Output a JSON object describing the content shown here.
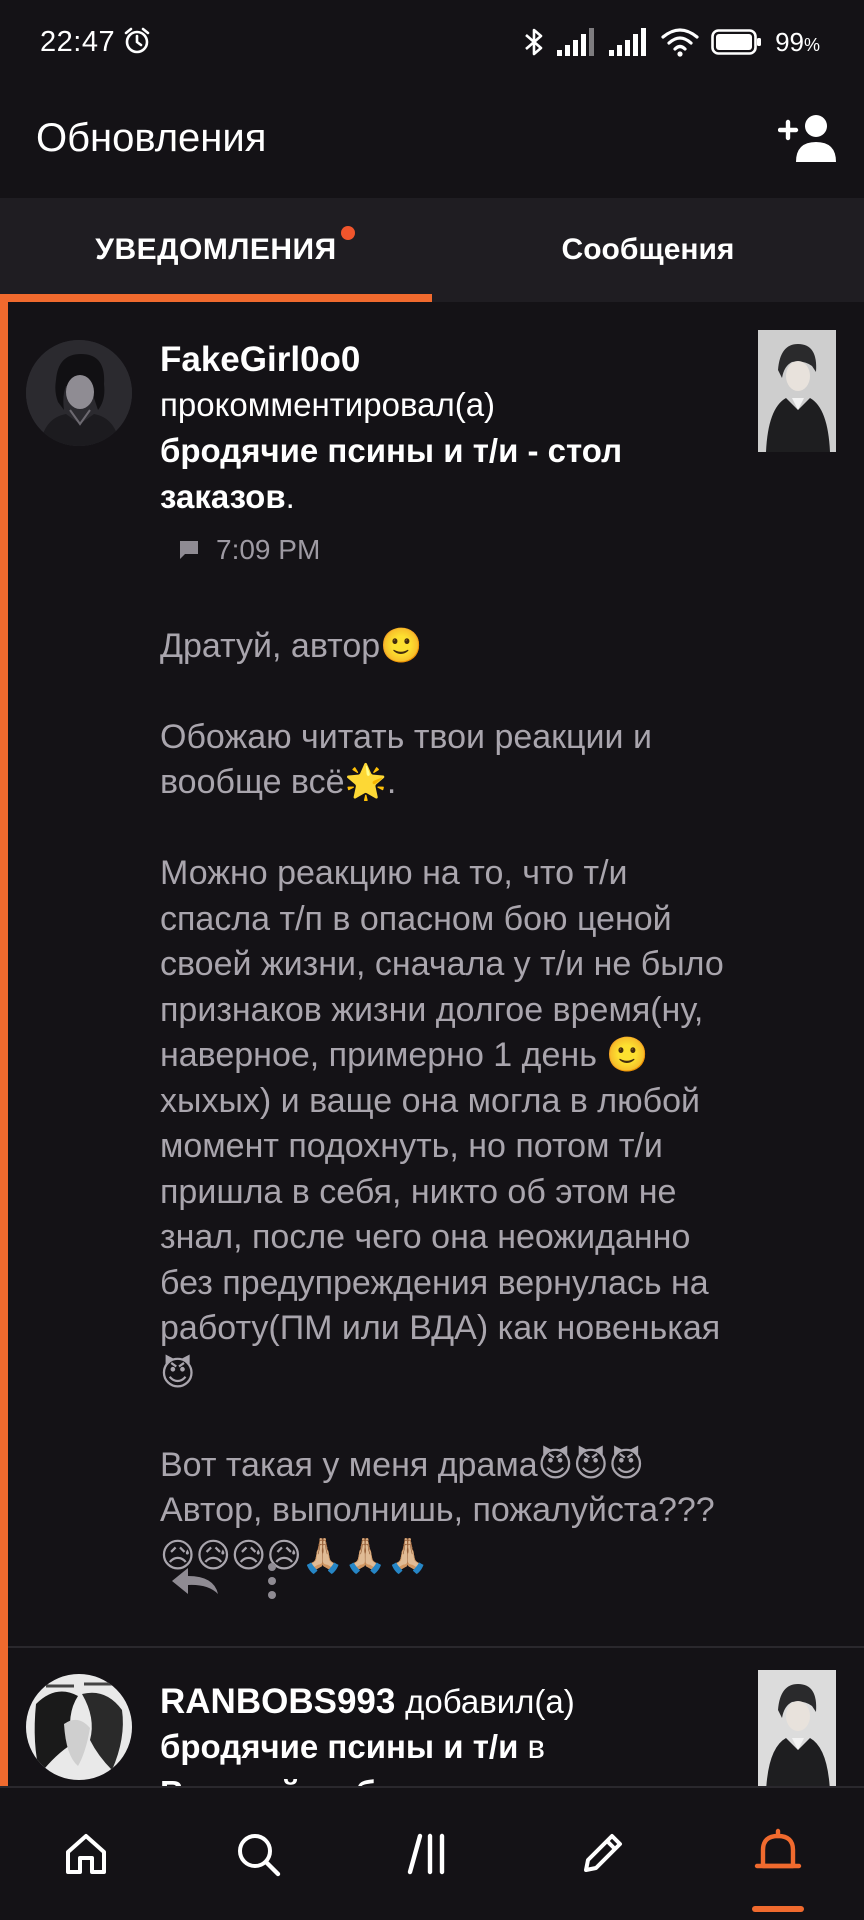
{
  "status_bar": {
    "time": "22:47",
    "battery_text": "99",
    "icons": [
      "alarm-icon",
      "bluetooth-icon",
      "signal-icon",
      "signal-icon",
      "wifi-icon",
      "battery-icon"
    ]
  },
  "header": {
    "title": "Обновления",
    "action_icon": "add-user-icon"
  },
  "tabs": [
    {
      "label": "УВЕДОМЛЕНИЯ",
      "active": true,
      "has_dot": true
    },
    {
      "label": "Сообщения",
      "active": false,
      "has_dot": false
    }
  ],
  "colors": {
    "accent": "#f06a2e",
    "background": "#141216",
    "tab_bar": "#1f1d22",
    "muted_text": "#a9a5ad",
    "dot": "#f0552c"
  },
  "notifications": [
    {
      "username": "FakeGirl0o0",
      "action": "прокомментировал(а)",
      "story": "бродячие псины и т/и - стол заказов",
      "story_suffix": ".",
      "time": "7:09 PM",
      "comment_lines": [
        "Дратуй, автор🙂",
        "Обожаю читать твои реакции и вообще всё🌟.",
        "Можно реакцию на то, что т/и спасла т/п в опасном бою ценой своей жизни, сначала у т/и не было признаков жизни долгое время(ну, наверное, примерно 1 день 🙂хыхых) и ваще она могла в любой момент подохнуть, но потом т/и пришла в себя, никто об этом не знал, после чего она неожиданно без предупреждения вернулась на работу(ПМ или ВДА) как новенькая😈",
        "Вот такая у меня драма😈😈😈Автор, выполнишь, пожалуйста??? 😥😥😥😥🙏🏼🙏🏼🙏🏼"
      ],
      "unread": true
    },
    {
      "username": "RANBOBS993",
      "action": "добавил(а)",
      "story": "бродячие псины и т/и",
      "story_tail": "в",
      "cut_line": "Великий из бродячих псов"
    }
  ],
  "bottom_nav": [
    {
      "icon": "home-icon",
      "active": false
    },
    {
      "icon": "search-icon",
      "active": false
    },
    {
      "icon": "library-icon",
      "active": false
    },
    {
      "icon": "pencil-icon",
      "active": false
    },
    {
      "icon": "bell-icon",
      "active": true
    }
  ]
}
